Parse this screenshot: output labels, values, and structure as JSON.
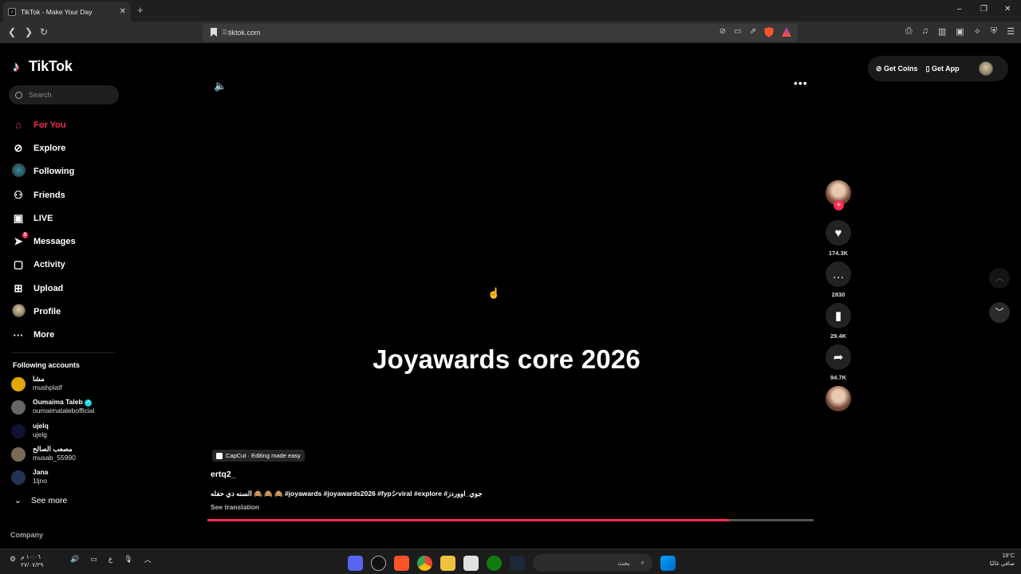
{
  "browser": {
    "tab_title": "TikTok - Make Your Day",
    "tab_close": "✕",
    "new_tab": "+",
    "url": "tiktok.com",
    "window_controls": [
      "–",
      "❐",
      "✕"
    ]
  },
  "tiktok": {
    "logo": "TikTok",
    "search_placeholder": "Search",
    "nav": [
      {
        "label": "For You",
        "icon": "home-icon"
      },
      {
        "label": "Explore",
        "icon": "compass-icon"
      },
      {
        "label": "Following",
        "icon": "following-avatar-icon"
      },
      {
        "label": "Friends",
        "icon": "friends-icon"
      },
      {
        "label": "LIVE",
        "icon": "live-icon"
      },
      {
        "label": "Messages",
        "icon": "messages-icon",
        "badge": "3"
      },
      {
        "label": "Activity",
        "icon": "activity-icon"
      },
      {
        "label": "Upload",
        "icon": "upload-icon"
      },
      {
        "label": "Profile",
        "icon": "profile-avatar-icon"
      },
      {
        "label": "More",
        "icon": "more-icon"
      }
    ],
    "following_title": "Following accounts",
    "accounts": [
      {
        "name": "مشا",
        "handle": "mushplatf",
        "color": "#e0a800"
      },
      {
        "name": "Oumaima Taleb",
        "handle": "oumaimataleb​official",
        "color": "#666",
        "verified": true
      },
      {
        "name": "ujelq",
        "handle": "ujelg",
        "color": "#111133"
      },
      {
        "name": "مصعب الصالح",
        "handle": "musab_55990",
        "color": "#7a6a55"
      },
      {
        "name": "Jana",
        "handle": "1ljno",
        "color": "#223355"
      }
    ],
    "see_more": "See more",
    "company": "Company",
    "get_coins": "Get Coins",
    "get_app": "Get App",
    "video": {
      "caption": "Joyawards core 2026",
      "capcut": "CapCut · Editing made easy",
      "author": "ertq2_",
      "description": "السنه دي حفله 🙈 🙈 🙈 #joyawards #joyawards2026 #fypシviral #explore #جوي_اووردز",
      "see_translation": "See translation",
      "progress_pct": 86
    },
    "actions": {
      "likes": "174.3K",
      "comments": "2830",
      "saves": "29.4K",
      "shares": "94.7K"
    }
  },
  "taskbar": {
    "search_text": "بحث",
    "clock_time": "١٠:٠٦ م",
    "clock_date": "٢٧/٠٧/٢٩",
    "weather_temp": "18°C",
    "weather_desc": "صافي غالبًا",
    "lang": "ع"
  }
}
